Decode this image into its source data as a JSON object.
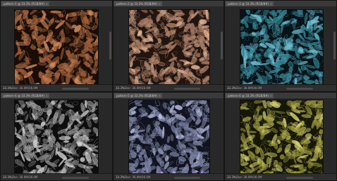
{
  "windows": [
    {
      "tab_title": "pattern-1 @ 33.3% (RGB/8#)",
      "zoom": "33.3%",
      "doc_info": "Doc: 36.0M/36.0M",
      "tint": "copper",
      "base": "#1b0d06",
      "leaf": "#9a5a34",
      "hi": "#d39063"
    },
    {
      "tab_title": "pattern-2 @ 33.3% (RGB/8#)",
      "zoom": "33.3%",
      "doc_info": "Doc: 36.0M/36.0M",
      "tint": "tan",
      "base": "#22140e",
      "leaf": "#a87b63",
      "hi": "#e2b699"
    },
    {
      "tab_title": "pattern-3 @ 33.3% (RGB/8#)",
      "zoom": "33.3%",
      "doc_info": "Doc: 36.0M/36.0M",
      "tint": "teal",
      "base": "#061318",
      "leaf": "#2f7d8e",
      "hi": "#75c4d6"
    },
    {
      "tab_title": "pattern-4 @ 33.3% (RGB/8#)",
      "zoom": "33.3%",
      "doc_info": "Doc: 36.0M/36.0M",
      "tint": "grey",
      "base": "#0d0d0d",
      "leaf": "#7d7d7d",
      "hi": "#d8d8d8"
    },
    {
      "tab_title": "pattern-5 @ 33.3% (RGB/8#)",
      "zoom": "33.3%",
      "doc_info": "Doc: 36.0M/36.0M",
      "tint": "lavender",
      "base": "#111320",
      "leaf": "#6e7596",
      "hi": "#b9c1e3"
    },
    {
      "tab_title": "pattern-6 @ 33.3% (RGB/8#)",
      "zoom": "33.3%",
      "doc_info": "Doc: 36.0M/36.0M",
      "tint": "olive",
      "base": "#171706",
      "leaf": "#8f8d36",
      "hi": "#d7d372"
    }
  ]
}
